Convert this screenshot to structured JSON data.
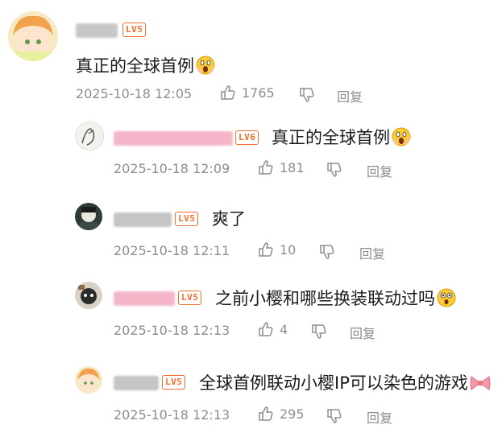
{
  "comments": [
    {
      "text": "真正的全球首例",
      "level": "LV5",
      "time": "2025-10-18 12:05",
      "likes": "1765",
      "reply": "回复",
      "emoji_icon": "screaming-face-icon"
    },
    {
      "text": "真正的全球首例",
      "level": "LV6",
      "time": "2025-10-18 12:09",
      "likes": "181",
      "reply": "回复",
      "emoji_icon": "screaming-face-icon"
    },
    {
      "text": "爽了",
      "level": "LV5",
      "time": "2025-10-18 12:11",
      "likes": "10",
      "reply": "回复"
    },
    {
      "text": "之前小樱和哪些换装联动过吗",
      "level": "LV5",
      "time": "2025-10-18 12:13",
      "likes": "4",
      "reply": "回复",
      "emoji_icon": "surprised-face-icon"
    },
    {
      "text": "全球首例联动小樱IP可以染色的游戏",
      "level": "LV5",
      "time": "2025-10-18 12:13",
      "likes": "295",
      "reply": "回复",
      "emoji_icon": "bow-icon"
    }
  ],
  "colors": {
    "level_badge": "#f36d2d",
    "meta_text": "#8d8d8d",
    "blurred_name_pink": "#f4b6c8",
    "blurred_name_gray": "#b8b8b8"
  }
}
